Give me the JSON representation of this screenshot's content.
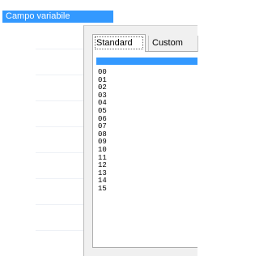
{
  "window": {
    "title": "Campo variabile"
  },
  "tabs": [
    {
      "label": "Standard"
    },
    {
      "label": "Custom"
    }
  ],
  "list": {
    "items": [
      "",
      "00",
      "01",
      "02",
      "03",
      "04",
      "05",
      "06",
      "07",
      "08",
      "09",
      "10",
      "11",
      "12",
      "13",
      "14",
      "15"
    ]
  },
  "colors": {
    "selection": "#3399ff"
  }
}
